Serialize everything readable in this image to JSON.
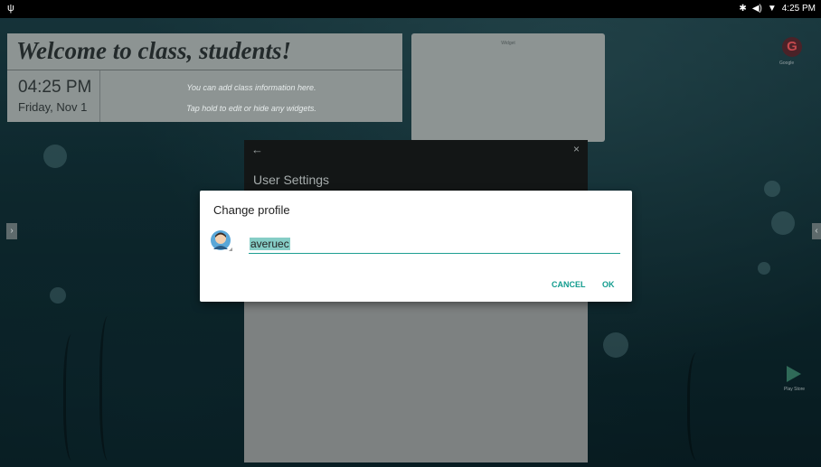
{
  "status_bar": {
    "time": "4:25 PM",
    "left_icon": "usb-icon",
    "right_icons": [
      "bluetooth-icon",
      "volume-icon",
      "wifi-icon"
    ]
  },
  "welcome_widget": {
    "title": "Welcome to class, students!",
    "time": "04:25 PM",
    "date": "Friday, Nov 1",
    "info_line1": "You can add class information here.",
    "info_line2": "Tap hold to edit or hide any widgets."
  },
  "side_widget": {
    "label": "Widget"
  },
  "launcher": {
    "g_label": "Google",
    "play_label": "Play Store"
  },
  "settings": {
    "back_glyph": "←",
    "close_glyph": "×",
    "title": "User Settings"
  },
  "dialog": {
    "title": "Change profile",
    "username": "averuec",
    "cancel_label": "CANCEL",
    "ok_label": "OK"
  },
  "colors": {
    "accent": "#129c8e",
    "dialog_bg": "#ffffff",
    "panel_bg": "#8d9493"
  }
}
